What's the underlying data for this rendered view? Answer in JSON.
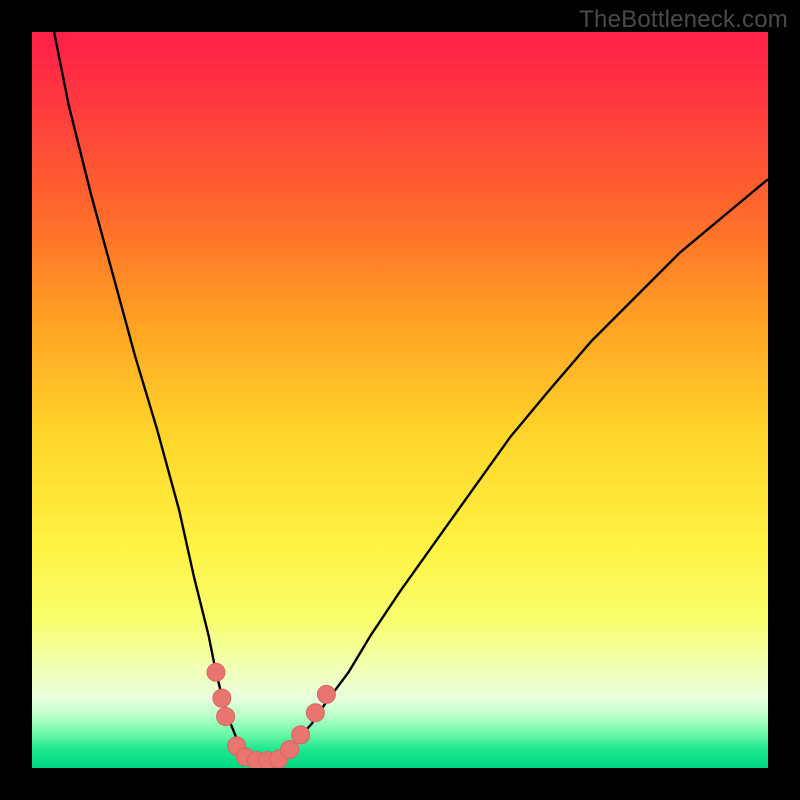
{
  "watermark": "TheBottleneck.com",
  "colors": {
    "frame": "#000000",
    "watermark": "#4a4a4a",
    "curve_stroke": "#000000",
    "marker_fill": "#e8756f",
    "marker_stroke": "#d8655f"
  },
  "gradient_stops": [
    {
      "offset": 0.0,
      "color": "#ff1f47"
    },
    {
      "offset": 0.1,
      "color": "#ff3a3f"
    },
    {
      "offset": 0.25,
      "color": "#ff6a2a"
    },
    {
      "offset": 0.4,
      "color": "#ffa423"
    },
    {
      "offset": 0.55,
      "color": "#ffd62a"
    },
    {
      "offset": 0.7,
      "color": "#fff344"
    },
    {
      "offset": 0.8,
      "color": "#f8ff6e"
    },
    {
      "offset": 0.86,
      "color": "#f2ffb0"
    },
    {
      "offset": 0.905,
      "color": "#e8ffdd"
    },
    {
      "offset": 0.93,
      "color": "#b8ffc8"
    },
    {
      "offset": 0.955,
      "color": "#68f8a8"
    },
    {
      "offset": 0.975,
      "color": "#1de68e"
    },
    {
      "offset": 1.0,
      "color": "#00d884"
    }
  ],
  "chart_data": {
    "type": "line",
    "title": "",
    "xlabel": "",
    "ylabel": "",
    "xlim": [
      0,
      100
    ],
    "ylim": [
      0,
      100
    ],
    "series": [
      {
        "name": "bottleneck-curve",
        "x": [
          3,
          5,
          8,
          11,
          14,
          17,
          20,
          22,
          24,
          25,
          26,
          27,
          28,
          29,
          30,
          31,
          32,
          33,
          34,
          36,
          38,
          40,
          43,
          46,
          50,
          55,
          60,
          65,
          70,
          76,
          82,
          88,
          94,
          100
        ],
        "y": [
          100,
          90,
          78,
          67,
          56,
          46,
          35,
          26,
          18,
          13,
          9,
          6,
          3.5,
          2,
          1.2,
          1,
          1,
          1.2,
          2,
          3.8,
          6,
          9,
          13,
          18,
          24,
          31,
          38,
          45,
          51,
          58,
          64,
          70,
          75,
          80
        ]
      }
    ],
    "markers": {
      "name": "data-points",
      "points": [
        {
          "x": 25.0,
          "y": 13.0
        },
        {
          "x": 25.8,
          "y": 9.5
        },
        {
          "x": 26.3,
          "y": 7.0
        },
        {
          "x": 27.8,
          "y": 3.0
        },
        {
          "x": 29.0,
          "y": 1.5
        },
        {
          "x": 30.5,
          "y": 1.0
        },
        {
          "x": 32.0,
          "y": 1.0
        },
        {
          "x": 33.5,
          "y": 1.2
        },
        {
          "x": 35.0,
          "y": 2.5
        },
        {
          "x": 36.5,
          "y": 4.5
        },
        {
          "x": 38.5,
          "y": 7.5
        },
        {
          "x": 40.0,
          "y": 10.0
        }
      ]
    }
  }
}
